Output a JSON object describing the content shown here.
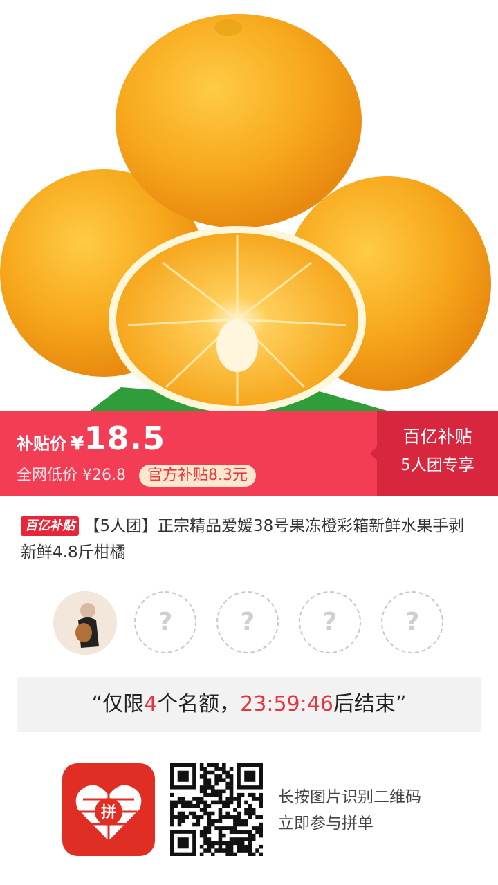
{
  "product_image": {
    "alt": "oranges-photo"
  },
  "price_banner": {
    "subsidy_label": "补贴价",
    "currency": "¥",
    "price": "18.5",
    "market_label": "全网低价 ¥26.8",
    "official_subsidy": "官方补贴8.3元",
    "badge_top": "百亿补贴",
    "badge_bottom": "5人团专享"
  },
  "product": {
    "brand_tag": "百亿补贴",
    "title": "【5人团】正宗精品爱媛38号果冻橙彩箱新鲜水果手剥新鲜4.8斤柑橘"
  },
  "group": {
    "filled_members": 1,
    "total_members": 5,
    "empty_slot_symbol": "?"
  },
  "notice": {
    "open_quote": "“",
    "prefix": "仅限",
    "count": "4",
    "middle": "个名额，",
    "countdown": "23:59:46",
    "suffix": "后结束",
    "close_quote": "”"
  },
  "footer": {
    "line1": "长按图片识别二维码",
    "line2": "立即参与拼单",
    "app_icon": "pinduoduo-logo",
    "logo_char": "拼"
  },
  "colors": {
    "banner_red": "#f23d54",
    "badge_red": "#d8263f",
    "highlight_red": "#e8333d",
    "app_red": "#e02e24"
  }
}
